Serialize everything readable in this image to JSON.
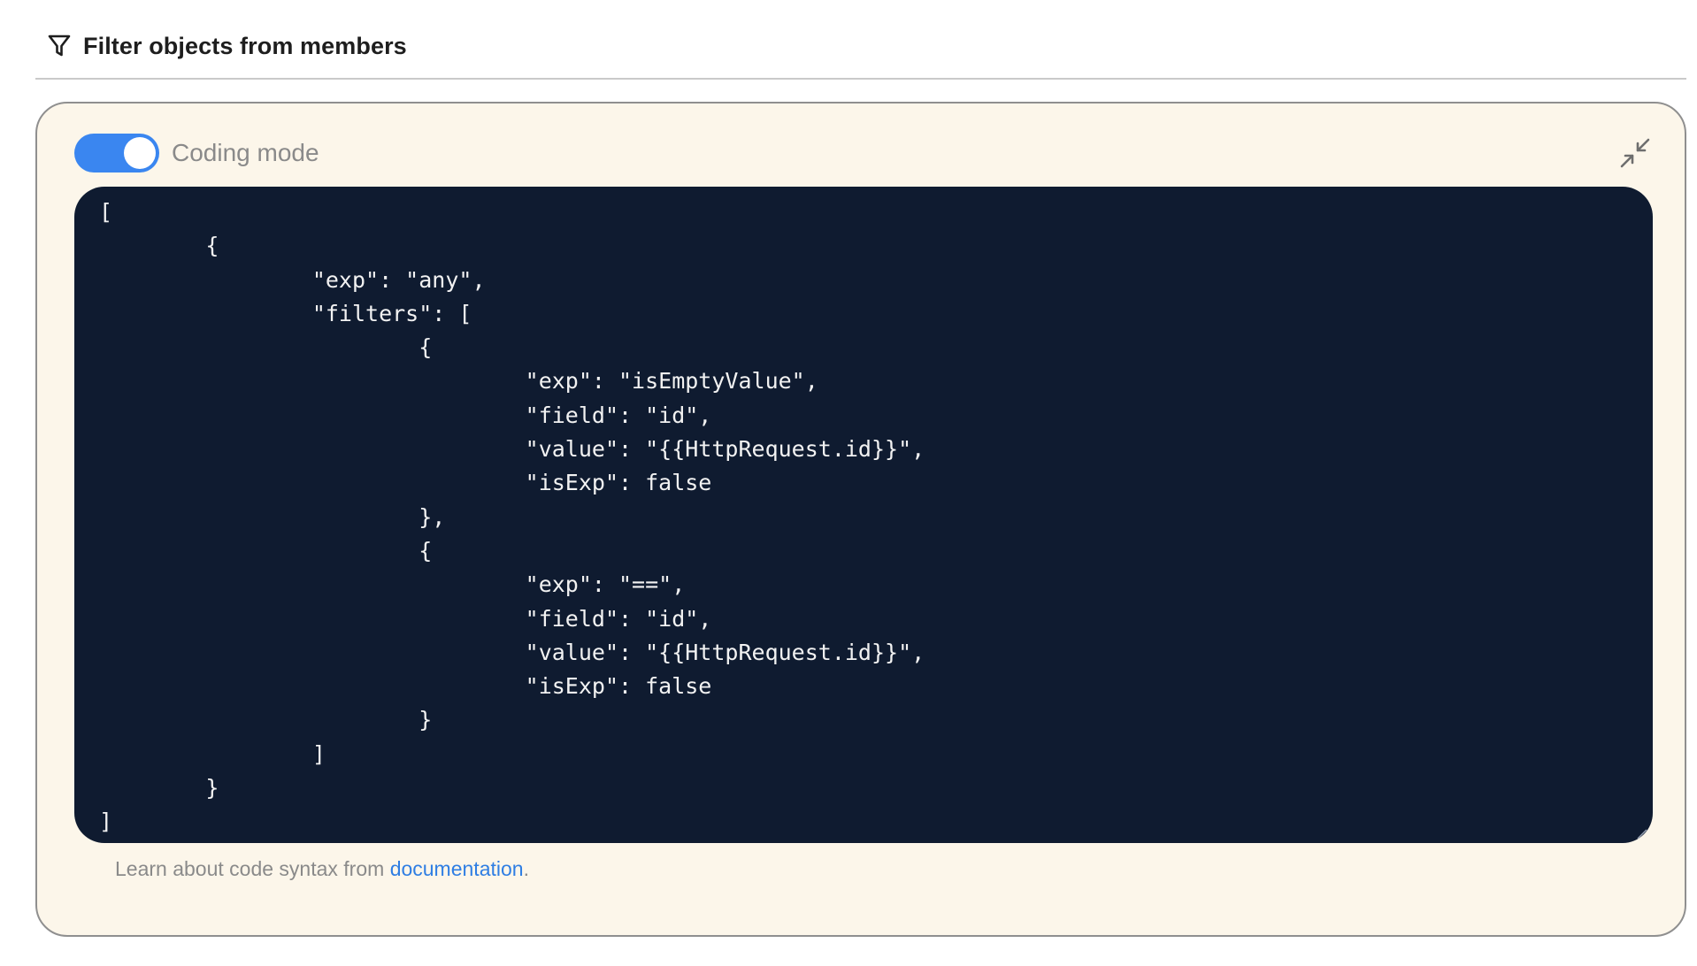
{
  "header": {
    "icon": "filter-icon",
    "title": "Filter objects from members"
  },
  "panel": {
    "toggle": {
      "label": "Coding mode",
      "on": true,
      "color": "#3a86f0"
    },
    "collapse_icon": "collapse-arrows-icon",
    "code": "[\n\t{\n\t\t\"exp\": \"any\",\n\t\t\"filters\": [\n\t\t\t{\n\t\t\t\t\"exp\": \"isEmptyValue\",\n\t\t\t\t\"field\": \"id\",\n\t\t\t\t\"value\": \"{{HttpRequest.id}}\",\n\t\t\t\t\"isExp\": false\n\t\t\t},\n\t\t\t{\n\t\t\t\t\"exp\": \"==\",\n\t\t\t\t\"field\": \"id\",\n\t\t\t\t\"value\": \"{{HttpRequest.id}}\",\n\t\t\t\t\"isExp\": false\n\t\t\t}\n\t\t]\n\t}\n]",
    "help": {
      "prefix": "Learn about code syntax from ",
      "link_text": "documentation",
      "suffix": "."
    }
  },
  "colors": {
    "panel_bg": "#fcf6ea",
    "editor_bg": "#0f1b30",
    "link": "#2f7ee3"
  }
}
